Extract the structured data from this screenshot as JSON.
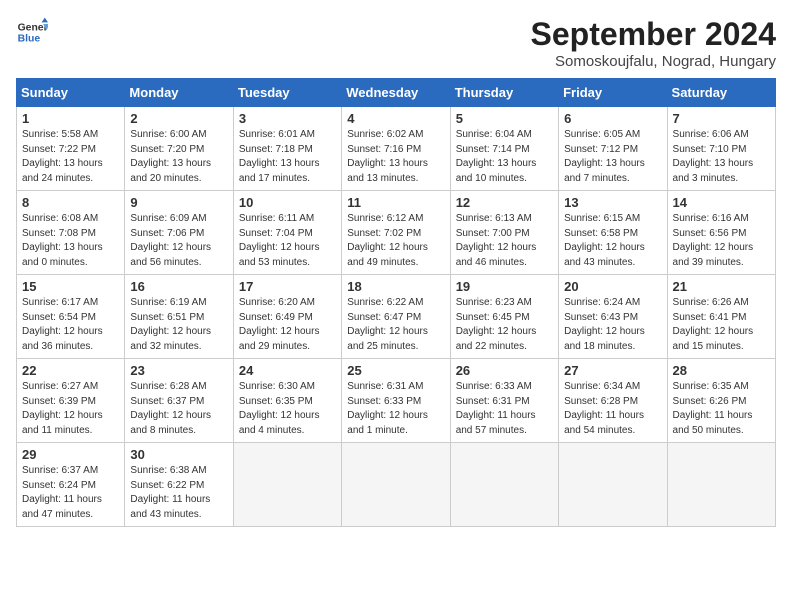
{
  "logo": {
    "line1": "General",
    "line2": "Blue"
  },
  "title": "September 2024",
  "location": "Somoskoujfalu, Nograd, Hungary",
  "weekdays": [
    "Sunday",
    "Monday",
    "Tuesday",
    "Wednesday",
    "Thursday",
    "Friday",
    "Saturday"
  ],
  "weeks": [
    [
      {
        "day": "1",
        "rise": "5:58 AM",
        "set": "7:22 PM",
        "daylight": "13 hours and 24 minutes."
      },
      {
        "day": "2",
        "rise": "6:00 AM",
        "set": "7:20 PM",
        "daylight": "13 hours and 20 minutes."
      },
      {
        "day": "3",
        "rise": "6:01 AM",
        "set": "7:18 PM",
        "daylight": "13 hours and 17 minutes."
      },
      {
        "day": "4",
        "rise": "6:02 AM",
        "set": "7:16 PM",
        "daylight": "13 hours and 13 minutes."
      },
      {
        "day": "5",
        "rise": "6:04 AM",
        "set": "7:14 PM",
        "daylight": "13 hours and 10 minutes."
      },
      {
        "day": "6",
        "rise": "6:05 AM",
        "set": "7:12 PM",
        "daylight": "13 hours and 7 minutes."
      },
      {
        "day": "7",
        "rise": "6:06 AM",
        "set": "7:10 PM",
        "daylight": "13 hours and 3 minutes."
      }
    ],
    [
      {
        "day": "8",
        "rise": "6:08 AM",
        "set": "7:08 PM",
        "daylight": "13 hours and 0 minutes."
      },
      {
        "day": "9",
        "rise": "6:09 AM",
        "set": "7:06 PM",
        "daylight": "12 hours and 56 minutes."
      },
      {
        "day": "10",
        "rise": "6:11 AM",
        "set": "7:04 PM",
        "daylight": "12 hours and 53 minutes."
      },
      {
        "day": "11",
        "rise": "6:12 AM",
        "set": "7:02 PM",
        "daylight": "12 hours and 49 minutes."
      },
      {
        "day": "12",
        "rise": "6:13 AM",
        "set": "7:00 PM",
        "daylight": "12 hours and 46 minutes."
      },
      {
        "day": "13",
        "rise": "6:15 AM",
        "set": "6:58 PM",
        "daylight": "12 hours and 43 minutes."
      },
      {
        "day": "14",
        "rise": "6:16 AM",
        "set": "6:56 PM",
        "daylight": "12 hours and 39 minutes."
      }
    ],
    [
      {
        "day": "15",
        "rise": "6:17 AM",
        "set": "6:54 PM",
        "daylight": "12 hours and 36 minutes."
      },
      {
        "day": "16",
        "rise": "6:19 AM",
        "set": "6:51 PM",
        "daylight": "12 hours and 32 minutes."
      },
      {
        "day": "17",
        "rise": "6:20 AM",
        "set": "6:49 PM",
        "daylight": "12 hours and 29 minutes."
      },
      {
        "day": "18",
        "rise": "6:22 AM",
        "set": "6:47 PM",
        "daylight": "12 hours and 25 minutes."
      },
      {
        "day": "19",
        "rise": "6:23 AM",
        "set": "6:45 PM",
        "daylight": "12 hours and 22 minutes."
      },
      {
        "day": "20",
        "rise": "6:24 AM",
        "set": "6:43 PM",
        "daylight": "12 hours and 18 minutes."
      },
      {
        "day": "21",
        "rise": "6:26 AM",
        "set": "6:41 PM",
        "daylight": "12 hours and 15 minutes."
      }
    ],
    [
      {
        "day": "22",
        "rise": "6:27 AM",
        "set": "6:39 PM",
        "daylight": "12 hours and 11 minutes."
      },
      {
        "day": "23",
        "rise": "6:28 AM",
        "set": "6:37 PM",
        "daylight": "12 hours and 8 minutes."
      },
      {
        "day": "24",
        "rise": "6:30 AM",
        "set": "6:35 PM",
        "daylight": "12 hours and 4 minutes."
      },
      {
        "day": "25",
        "rise": "6:31 AM",
        "set": "6:33 PM",
        "daylight": "12 hours and 1 minute."
      },
      {
        "day": "26",
        "rise": "6:33 AM",
        "set": "6:31 PM",
        "daylight": "11 hours and 57 minutes."
      },
      {
        "day": "27",
        "rise": "6:34 AM",
        "set": "6:28 PM",
        "daylight": "11 hours and 54 minutes."
      },
      {
        "day": "28",
        "rise": "6:35 AM",
        "set": "6:26 PM",
        "daylight": "11 hours and 50 minutes."
      }
    ],
    [
      {
        "day": "29",
        "rise": "6:37 AM",
        "set": "6:24 PM",
        "daylight": "11 hours and 47 minutes."
      },
      {
        "day": "30",
        "rise": "6:38 AM",
        "set": "6:22 PM",
        "daylight": "11 hours and 43 minutes."
      },
      null,
      null,
      null,
      null,
      null
    ]
  ]
}
